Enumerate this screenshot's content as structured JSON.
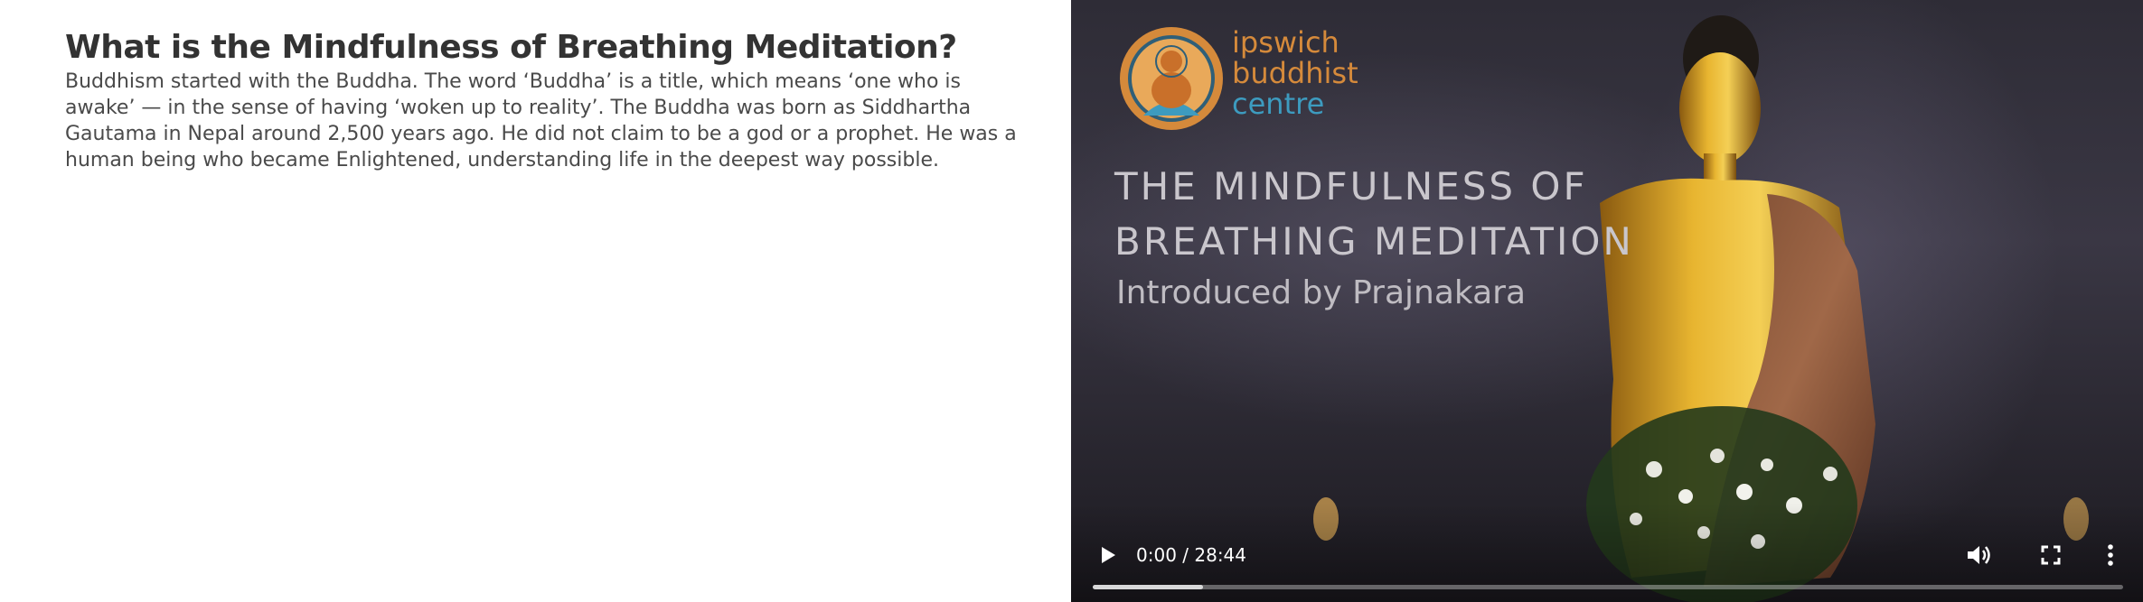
{
  "article": {
    "heading": "What is the Mindfulness of Breathing Meditation?",
    "paragraph": "Buddhism started with the Buddha. The word ‘Buddha’ is a title, which means ‘one who is awake’ — in the sense of having ‘woken up to reality’. The Buddha was born as Siddhartha Gautama in Nepal around 2,500 years ago. He did not claim to be a god or a prophet. He was a human being who became Enlightened, understanding life in the deepest way possible."
  },
  "video": {
    "logo": {
      "line1": "ipswich",
      "line2": "buddhist",
      "line3": "centre"
    },
    "title_line1": "THE MINDFULNESS OF",
    "title_line2": "BREATHING MEDITATION",
    "subtitle": "Introduced by Prajnakara",
    "controls": {
      "time": "0:00 / 28:44",
      "buffered_fraction": 0.107,
      "icons": [
        "play-icon",
        "volume-icon",
        "fullscreen-icon",
        "more-options-icon"
      ]
    }
  },
  "colors": {
    "heading": "#333333",
    "body_text": "#4a4a4a",
    "logo_orange": "#d58a3b",
    "logo_blue": "#3d9bbf",
    "video_bg": "#2e2c36"
  }
}
